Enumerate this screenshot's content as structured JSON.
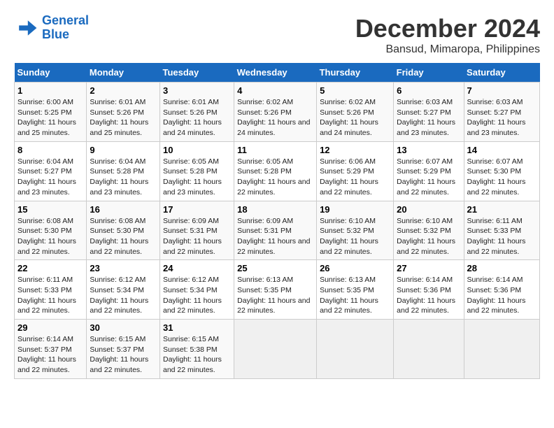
{
  "logo": {
    "line1": "General",
    "line2": "Blue"
  },
  "title": "December 2024",
  "subtitle": "Bansud, Mimaropa, Philippines",
  "days_header": [
    "Sunday",
    "Monday",
    "Tuesday",
    "Wednesday",
    "Thursday",
    "Friday",
    "Saturday"
  ],
  "weeks": [
    [
      {
        "day": "1",
        "text": "Sunrise: 6:00 AM\nSunset: 5:25 PM\nDaylight: 11 hours and 25 minutes."
      },
      {
        "day": "2",
        "text": "Sunrise: 6:01 AM\nSunset: 5:26 PM\nDaylight: 11 hours and 25 minutes."
      },
      {
        "day": "3",
        "text": "Sunrise: 6:01 AM\nSunset: 5:26 PM\nDaylight: 11 hours and 24 minutes."
      },
      {
        "day": "4",
        "text": "Sunrise: 6:02 AM\nSunset: 5:26 PM\nDaylight: 11 hours and 24 minutes."
      },
      {
        "day": "5",
        "text": "Sunrise: 6:02 AM\nSunset: 5:26 PM\nDaylight: 11 hours and 24 minutes."
      },
      {
        "day": "6",
        "text": "Sunrise: 6:03 AM\nSunset: 5:27 PM\nDaylight: 11 hours and 23 minutes."
      },
      {
        "day": "7",
        "text": "Sunrise: 6:03 AM\nSunset: 5:27 PM\nDaylight: 11 hours and 23 minutes."
      }
    ],
    [
      {
        "day": "8",
        "text": "Sunrise: 6:04 AM\nSunset: 5:27 PM\nDaylight: 11 hours and 23 minutes."
      },
      {
        "day": "9",
        "text": "Sunrise: 6:04 AM\nSunset: 5:28 PM\nDaylight: 11 hours and 23 minutes."
      },
      {
        "day": "10",
        "text": "Sunrise: 6:05 AM\nSunset: 5:28 PM\nDaylight: 11 hours and 23 minutes."
      },
      {
        "day": "11",
        "text": "Sunrise: 6:05 AM\nSunset: 5:28 PM\nDaylight: 11 hours and 22 minutes."
      },
      {
        "day": "12",
        "text": "Sunrise: 6:06 AM\nSunset: 5:29 PM\nDaylight: 11 hours and 22 minutes."
      },
      {
        "day": "13",
        "text": "Sunrise: 6:07 AM\nSunset: 5:29 PM\nDaylight: 11 hours and 22 minutes."
      },
      {
        "day": "14",
        "text": "Sunrise: 6:07 AM\nSunset: 5:30 PM\nDaylight: 11 hours and 22 minutes."
      }
    ],
    [
      {
        "day": "15",
        "text": "Sunrise: 6:08 AM\nSunset: 5:30 PM\nDaylight: 11 hours and 22 minutes."
      },
      {
        "day": "16",
        "text": "Sunrise: 6:08 AM\nSunset: 5:30 PM\nDaylight: 11 hours and 22 minutes."
      },
      {
        "day": "17",
        "text": "Sunrise: 6:09 AM\nSunset: 5:31 PM\nDaylight: 11 hours and 22 minutes."
      },
      {
        "day": "18",
        "text": "Sunrise: 6:09 AM\nSunset: 5:31 PM\nDaylight: 11 hours and 22 minutes."
      },
      {
        "day": "19",
        "text": "Sunrise: 6:10 AM\nSunset: 5:32 PM\nDaylight: 11 hours and 22 minutes."
      },
      {
        "day": "20",
        "text": "Sunrise: 6:10 AM\nSunset: 5:32 PM\nDaylight: 11 hours and 22 minutes."
      },
      {
        "day": "21",
        "text": "Sunrise: 6:11 AM\nSunset: 5:33 PM\nDaylight: 11 hours and 22 minutes."
      }
    ],
    [
      {
        "day": "22",
        "text": "Sunrise: 6:11 AM\nSunset: 5:33 PM\nDaylight: 11 hours and 22 minutes."
      },
      {
        "day": "23",
        "text": "Sunrise: 6:12 AM\nSunset: 5:34 PM\nDaylight: 11 hours and 22 minutes."
      },
      {
        "day": "24",
        "text": "Sunrise: 6:12 AM\nSunset: 5:34 PM\nDaylight: 11 hours and 22 minutes."
      },
      {
        "day": "25",
        "text": "Sunrise: 6:13 AM\nSunset: 5:35 PM\nDaylight: 11 hours and 22 minutes."
      },
      {
        "day": "26",
        "text": "Sunrise: 6:13 AM\nSunset: 5:35 PM\nDaylight: 11 hours and 22 minutes."
      },
      {
        "day": "27",
        "text": "Sunrise: 6:14 AM\nSunset: 5:36 PM\nDaylight: 11 hours and 22 minutes."
      },
      {
        "day": "28",
        "text": "Sunrise: 6:14 AM\nSunset: 5:36 PM\nDaylight: 11 hours and 22 minutes."
      }
    ],
    [
      {
        "day": "29",
        "text": "Sunrise: 6:14 AM\nSunset: 5:37 PM\nDaylight: 11 hours and 22 minutes."
      },
      {
        "day": "30",
        "text": "Sunrise: 6:15 AM\nSunset: 5:37 PM\nDaylight: 11 hours and 22 minutes."
      },
      {
        "day": "31",
        "text": "Sunrise: 6:15 AM\nSunset: 5:38 PM\nDaylight: 11 hours and 22 minutes."
      },
      null,
      null,
      null,
      null
    ]
  ]
}
